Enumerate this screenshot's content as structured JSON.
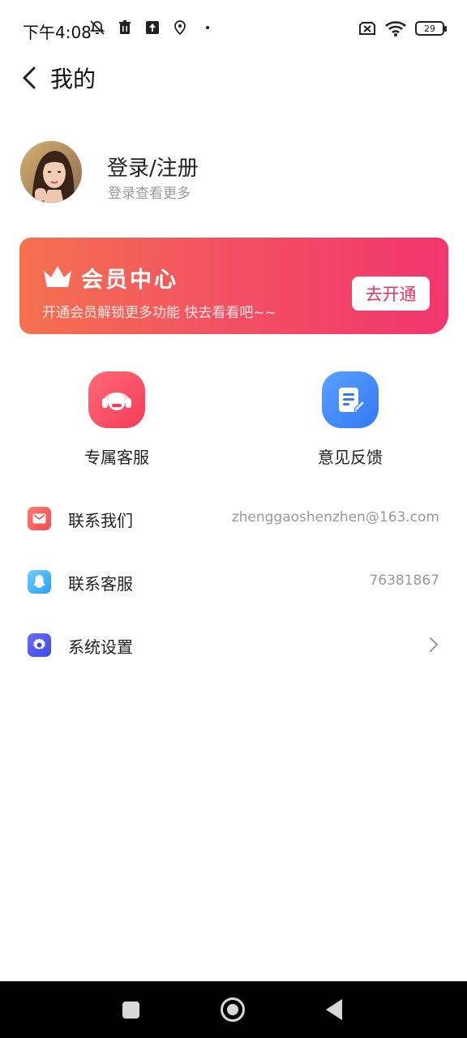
{
  "status_bar": {
    "time": "下午4:08",
    "icons_left": [
      "muted-bell-icon",
      "trash-icon",
      "upload-icon",
      "location-icon",
      "dot-icon"
    ],
    "icons_right": [
      "no-sim-icon",
      "wifi-icon",
      "battery-icon"
    ],
    "battery": "29"
  },
  "header": {
    "title": "我的"
  },
  "profile": {
    "title": "登录/注册",
    "subtitle": "登录查看更多"
  },
  "member_card": {
    "title": "会员中心",
    "subtitle": "开通会员解锁更多功能 快去看看吧~~",
    "button": "去开通"
  },
  "actions": [
    {
      "label": "专属客服",
      "icon": "headset-icon"
    },
    {
      "label": "意见反馈",
      "icon": "note-edit-icon"
    }
  ],
  "list": [
    {
      "label": "联系我们",
      "value": "zhenggaoshenzhen@163.com",
      "icon": "mail-icon"
    },
    {
      "label": "联系客服",
      "value": "76381867",
      "icon": "qq-icon"
    },
    {
      "label": "系统设置",
      "value": "",
      "icon": "settings-icon"
    }
  ],
  "colors": {
    "member_gradient_start": "#f4714f",
    "member_gradient_end": "#f2356e",
    "member_button_text": "#e8335f",
    "service_icon": "#f33c58",
    "feedback_icon": "#3478f6"
  }
}
